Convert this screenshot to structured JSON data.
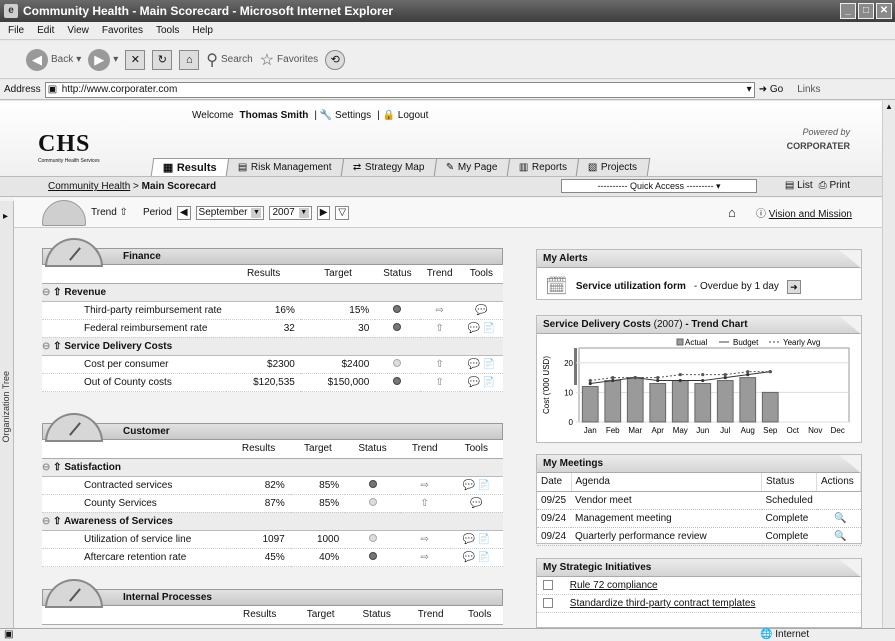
{
  "window": {
    "title": "Community Health - Main Scorecard - Microsoft Internet Explorer"
  },
  "menu": [
    "File",
    "Edit",
    "View",
    "Favorites",
    "Tools",
    "Help"
  ],
  "toolbar": {
    "back": "Back",
    "search": "Search",
    "favorites": "Favorites"
  },
  "address": {
    "label": "Address",
    "url": "http://www.corporater.com",
    "go": "Go",
    "links": "Links"
  },
  "header": {
    "logo": "CHS",
    "logo_sub": "Community Health Services",
    "welcome_prefix": "Welcome",
    "user": "Thomas Smith",
    "settings": "Settings",
    "logout": "Logout",
    "powered_by": "Powered by",
    "brand": "CORPORATER"
  },
  "tabs": [
    "Results",
    "Risk Management",
    "Strategy Map",
    "My Page",
    "Reports",
    "Projects"
  ],
  "breadcrumb": {
    "root": "Community Health",
    "current": "Main Scorecard",
    "quick_access": "---------- Quick Access ---------",
    "list": "List",
    "print": "Print"
  },
  "filter": {
    "trend": "Trend",
    "period": "Period",
    "month": "September",
    "year": "2007",
    "vision": "Vision and Mission"
  },
  "org_tree": "Organization Tree",
  "columns": {
    "results": "Results",
    "target": "Target",
    "status": "Status",
    "trend": "Trend",
    "tools": "Tools"
  },
  "panels": [
    {
      "title": "Finance",
      "sections": [
        {
          "name": "Revenue",
          "rows": [
            {
              "name": "Third-party reimbursement rate",
              "results": "16%",
              "target": "15%",
              "status": "dark",
              "trend": "right",
              "tools": 1
            },
            {
              "name": "Federal reimbursement rate",
              "results": "32",
              "target": "30",
              "status": "dark",
              "trend": "up",
              "tools": 2
            }
          ]
        },
        {
          "name": "Service Delivery Costs",
          "rows": [
            {
              "name": "Cost per consumer",
              "results": "$2300",
              "target": "$2400",
              "status": "light",
              "trend": "up",
              "tools": 2
            },
            {
              "name": "Out of County costs",
              "results": "$120,535",
              "target": "$150,000",
              "status": "dark",
              "trend": "up",
              "tools": 2
            }
          ]
        }
      ]
    },
    {
      "title": "Customer",
      "sections": [
        {
          "name": "Satisfaction",
          "rows": [
            {
              "name": "Contracted services",
              "results": "82%",
              "target": "85%",
              "status": "dark",
              "trend": "right",
              "tools": 2
            },
            {
              "name": "County Services",
              "results": "87%",
              "target": "85%",
              "status": "light",
              "trend": "up",
              "tools": 1
            }
          ]
        },
        {
          "name": "Awareness of Services",
          "rows": [
            {
              "name": "Utilization of service line",
              "results": "1097",
              "target": "1000",
              "status": "light",
              "trend": "right",
              "tools": 2
            },
            {
              "name": "Aftercare retention rate",
              "results": "45%",
              "target": "40%",
              "status": "dark",
              "trend": "right",
              "tools": 2
            }
          ]
        }
      ]
    },
    {
      "title": "Internal Processes",
      "sections": []
    }
  ],
  "alerts": {
    "title": "My Alerts",
    "item": "Service utilization form",
    "note": "- Overdue by 1 day"
  },
  "trend_chart": {
    "title": "Service Delivery Costs",
    "year": "(2007)",
    "suffix": "- Trend Chart"
  },
  "chart_data": {
    "type": "bar",
    "categories": [
      "Jan",
      "Feb",
      "Mar",
      "Apr",
      "May",
      "Jun",
      "Jul",
      "Aug",
      "Sep",
      "Oct",
      "Nov",
      "Dec"
    ],
    "series": [
      {
        "name": "Actual",
        "values": [
          12,
          14,
          15,
          13,
          14,
          13,
          14,
          15,
          10,
          null,
          null,
          null
        ]
      },
      {
        "name": "Budget",
        "values": [
          13,
          14,
          15,
          14,
          14,
          14,
          15,
          16,
          17,
          null,
          null,
          null
        ]
      },
      {
        "name": "Yearly Avg",
        "values": [
          14,
          15,
          15,
          15,
          16,
          16,
          16,
          17,
          17,
          null,
          null,
          null
        ]
      }
    ],
    "ylabel": "Cost ('000 USD)",
    "ylim": [
      0,
      25
    ],
    "yticks": [
      0,
      10,
      20
    ],
    "legend": "top-right"
  },
  "meetings": {
    "title": "My Meetings",
    "headers": [
      "Date",
      "Agenda",
      "Status",
      "Actions"
    ],
    "rows": [
      {
        "date": "09/25",
        "agenda": "Vendor meet",
        "status": "Scheduled",
        "action": false
      },
      {
        "date": "09/24",
        "agenda": "Management meeting",
        "status": "Complete",
        "action": true
      },
      {
        "date": "09/24",
        "agenda": "Quarterly performance review",
        "status": "Complete",
        "action": true
      }
    ]
  },
  "initiatives": {
    "title": "My Strategic Initiatives",
    "items": [
      "Rule 72 compliance",
      "Standardize third-party contract templates"
    ]
  },
  "status": {
    "zone": "Internet"
  }
}
